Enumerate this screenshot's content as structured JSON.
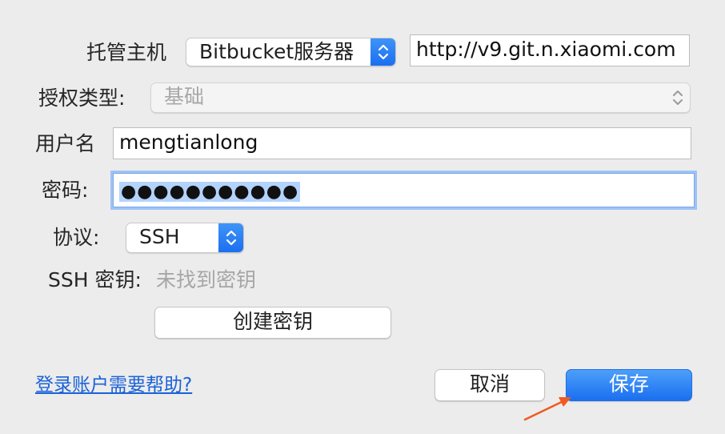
{
  "form": {
    "host": {
      "label": "托管主机",
      "type_value": "Bitbucket服务器",
      "url_value": "http://v9.git.n.xiaomi.com"
    },
    "auth": {
      "label": "授权类型:",
      "value": "基础"
    },
    "username": {
      "label": "用户名",
      "value": "mengtianlong"
    },
    "password": {
      "label": "密码:",
      "value": "●●●●●●●●●●●"
    },
    "protocol": {
      "label": "协议:",
      "value": "SSH"
    },
    "ssh_key": {
      "label": "SSH 密钥:",
      "status": "未找到密钥"
    },
    "create_key_button": "创建密钥"
  },
  "footer": {
    "help_link": "登录账户需要帮助?",
    "cancel_button": "取消",
    "save_button": "保存"
  },
  "colors": {
    "accent": "#1a6ff0",
    "annotation_arrow": "#f05a22",
    "link": "#1a62d8"
  }
}
